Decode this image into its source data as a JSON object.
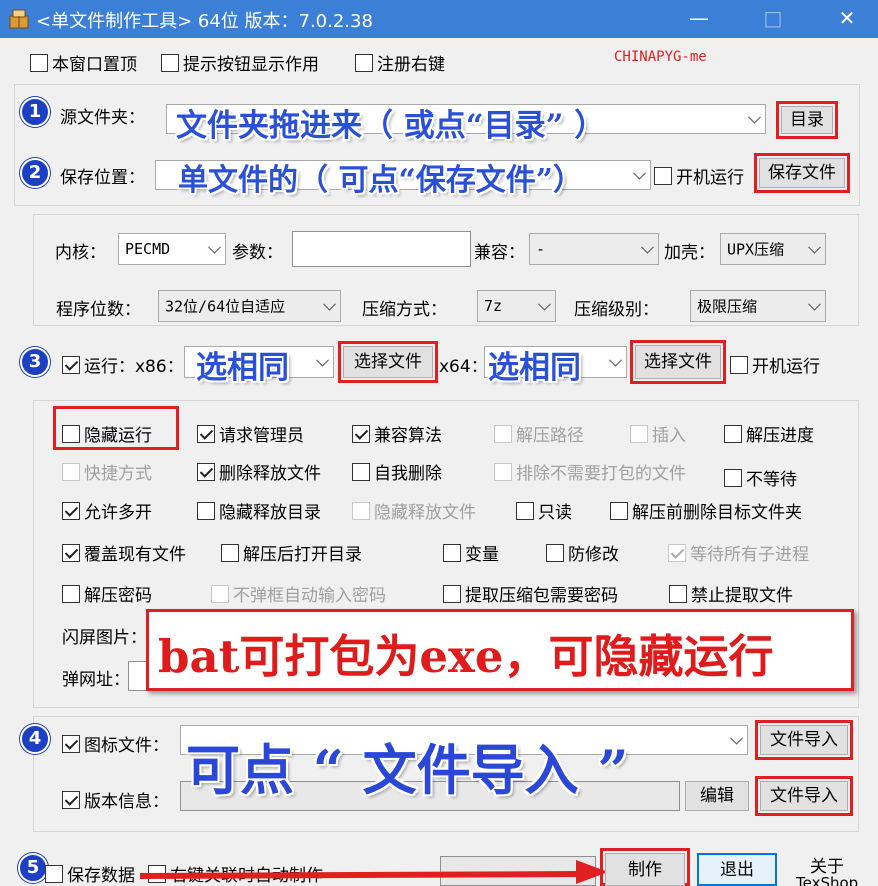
{
  "window": {
    "title": "<单文件制作工具> 64位 版本：7.0.2.38",
    "minimize_glyph": "—",
    "maximize_glyph": "□",
    "close_glyph": "✕",
    "app_icon": "package-icon"
  },
  "top_options": {
    "always_on_top": "本窗口置顶",
    "show_button_tips": "提示按钮显示作用",
    "register_context_menu": "注册右键",
    "watermark": "CHINAPYG-me"
  },
  "source": {
    "label": "源文件夹：",
    "dir_button": "目录",
    "annotation": "文件夹拖进来（ 或点“目录” ）",
    "step": "1"
  },
  "save": {
    "label": "保存位置：",
    "autostart": "开机运行",
    "save_button": "保存文件",
    "annotation": "单文件的（ 可点“保存文件”）",
    "step": "2"
  },
  "core": {
    "kernel_label": "内核：",
    "kernel_value": "PECMD",
    "params_label": "参数：",
    "params_value": "",
    "compat_label": "兼容：",
    "compat_value": "-",
    "pack_label": "加壳：",
    "pack_value": "UPX压缩",
    "bits_label": "程序位数：",
    "bits_value": "32位/64位自适应",
    "compress_label": "压缩方式：",
    "compress_value": "7z",
    "level_label": "压缩级别：",
    "level_value": "极限压缩"
  },
  "run": {
    "step": "3",
    "run_label": "运行：x86：",
    "choose_x86": "选择文件",
    "x64_label": "x64：",
    "choose_x64": "选择文件",
    "autostart": "开机运行",
    "annot_x86": "选相同",
    "annot_x64": "选相同"
  },
  "options": {
    "hidden_run": "隐藏运行",
    "request_admin": "请求管理员",
    "compat_algo": "兼容算法",
    "extract_path": "解压路径",
    "insert": "插入",
    "extract_progress": "解压进度",
    "shortcut": "快捷方式",
    "delete_released": "删除释放文件",
    "self_delete": "自我删除",
    "exclude_unpacked": "排除不需要打包的文件",
    "no_wait": "不等待",
    "allow_multi": "允许多开",
    "hide_release_dir": "隐藏释放目录",
    "hide_release_files": "隐藏释放文件",
    "readonly": "只读",
    "delete_target_before": "解压前删除目标文件夹",
    "overwrite_existing": "覆盖现有文件",
    "open_dir_after": "解压后打开目录",
    "variable": "变量",
    "tamper_proof": "防修改",
    "wait_children": "等待所有子进程",
    "extract_password": "解压密码",
    "auto_password": "不弹框自动输入密码",
    "extract_needs_password": "提取压缩包需要密码",
    "forbid_extract": "禁止提取文件",
    "splash_label": "闪屏图片：",
    "popup_url_label": "弹网址：",
    "annotation": "bat可打包为exe，可隐藏运行"
  },
  "meta": {
    "step": "4",
    "icon_file": "图标文件：",
    "version_info": "版本信息：",
    "import_button_1": "文件导入",
    "import_button_2": "文件导入",
    "edit_button": "编辑",
    "annotation": "可点 “ 文件导入 ”"
  },
  "bottom": {
    "step": "5",
    "save_data": "保存数据",
    "auto_make": "右键关联时自动制作",
    "make_button": "制作",
    "exit_button": "退出",
    "about_line1": "关于",
    "about_line2": "TexShop"
  }
}
